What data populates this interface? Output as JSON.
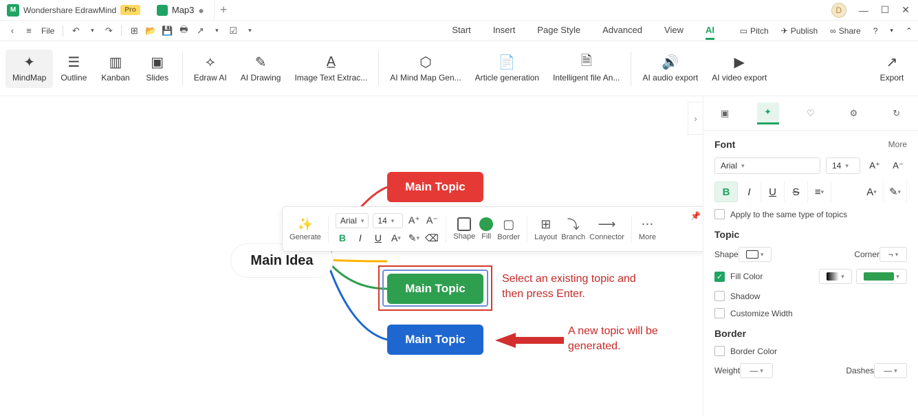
{
  "titlebar": {
    "app_name": "Wondershare EdrawMind",
    "pro": "Pro",
    "doc_name": "Map3",
    "avatar_letter": "D"
  },
  "quickbar": {
    "file": "File"
  },
  "menu": {
    "start": "Start",
    "insert": "Insert",
    "page_style": "Page Style",
    "advanced": "Advanced",
    "view": "View",
    "ai": "AI"
  },
  "right_actions": {
    "pitch": "Pitch",
    "publish": "Publish",
    "share": "Share"
  },
  "ribbon": {
    "mindmap": "MindMap",
    "outline": "Outline",
    "kanban": "Kanban",
    "slides": "Slides",
    "edraw_ai": "Edraw AI",
    "ai_drawing": "AI Drawing",
    "image_text": "Image Text Extrac...",
    "ai_mindmap": "AI Mind Map Gen...",
    "article_gen": "Article generation",
    "intelligent_file": "Intelligent file An...",
    "ai_audio": "AI audio export",
    "ai_video": "AI video export",
    "export": "Export"
  },
  "canvas": {
    "main_idea": "Main Idea",
    "topic1": "Main Topic",
    "topic2": "Main Topic",
    "topic3": "Main Topic",
    "anno1": "Select an existing topic and then press Enter.",
    "anno2": "A new topic will be generated."
  },
  "float_toolbar": {
    "generate": "Generate",
    "font": "Arial",
    "size": "14",
    "shape": "Shape",
    "fill": "Fill",
    "border": "Border",
    "layout": "Layout",
    "branch": "Branch",
    "connector": "Connector",
    "more": "More"
  },
  "rpanel": {
    "font_head": "Font",
    "more": "More",
    "font_family": "Arial",
    "font_size": "14",
    "apply_same": "Apply to the same type of topics",
    "topic_head": "Topic",
    "shape": "Shape",
    "corner": "Corner",
    "fill_color": "Fill Color",
    "shadow": "Shadow",
    "customize_width": "Customize Width",
    "border_head": "Border",
    "border_color": "Border Color",
    "weight": "Weight",
    "dashes": "Dashes"
  }
}
